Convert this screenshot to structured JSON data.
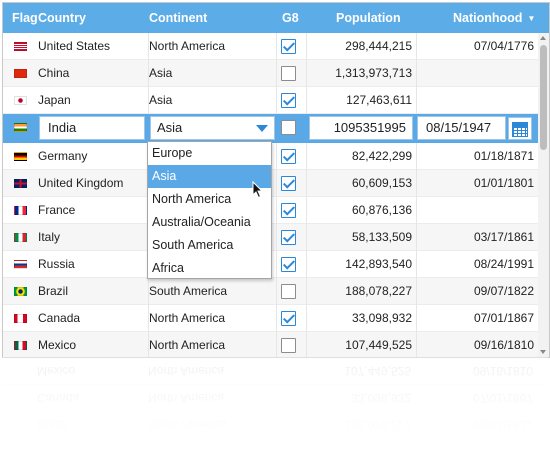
{
  "columns": {
    "flag": "Flag",
    "country": "Country",
    "continent": "Continent",
    "g8": "G8",
    "population": "Population",
    "nationhood": "Nationhood"
  },
  "rows": [
    {
      "flag": "us-flag",
      "country": "United States",
      "continent": "North America",
      "g8": true,
      "population": "298,444,215",
      "nationhood": "07/04/1776"
    },
    {
      "flag": "cn-flag",
      "country": "China",
      "continent": "Asia",
      "g8": false,
      "population": "1,313,973,713",
      "nationhood": ""
    },
    {
      "flag": "jp-flag",
      "country": "Japan",
      "continent": "Asia",
      "g8": true,
      "population": "127,463,611",
      "nationhood": ""
    },
    {
      "flag": "in-flag",
      "country": "India",
      "continent": "Asia",
      "g8": false,
      "population": "1095351995",
      "nationhood": "08/15/1947",
      "editing": true
    },
    {
      "flag": "de-flag",
      "country": "Germany",
      "continent": "",
      "g8": true,
      "population": "82,422,299",
      "nationhood": "01/18/1871"
    },
    {
      "flag": "gb-flag",
      "country": "United Kingdom",
      "continent": "",
      "g8": true,
      "population": "60,609,153",
      "nationhood": "01/01/1801"
    },
    {
      "flag": "fr-flag",
      "country": "France",
      "continent": "",
      "g8": true,
      "population": "60,876,136",
      "nationhood": ""
    },
    {
      "flag": "it-flag",
      "country": "Italy",
      "continent": "",
      "g8": true,
      "population": "58,133,509",
      "nationhood": "03/17/1861"
    },
    {
      "flag": "ru-flag",
      "country": "Russia",
      "continent": "",
      "g8": true,
      "population": "142,893,540",
      "nationhood": "08/24/1991"
    },
    {
      "flag": "br-flag",
      "country": "Brazil",
      "continent": "South America",
      "g8": false,
      "population": "188,078,227",
      "nationhood": "09/07/1822"
    },
    {
      "flag": "ca-flag",
      "country": "Canada",
      "continent": "North America",
      "g8": true,
      "population": "33,098,932",
      "nationhood": "07/01/1867"
    },
    {
      "flag": "mx-flag",
      "country": "Mexico",
      "continent": "North America",
      "g8": false,
      "population": "107,449,525",
      "nationhood": "09/16/1810"
    }
  ],
  "dropdown": {
    "options": [
      "Europe",
      "Asia",
      "North America",
      "Australia/Oceania",
      "South America",
      "Africa"
    ],
    "selected": "Asia"
  },
  "colors": {
    "header_bg": "#5cace8",
    "accent": "#2b88d9",
    "edit_row_bg": "#5aa9e6"
  },
  "icons": {
    "sort": "sort-descending-icon",
    "calendar": "calendar-icon",
    "dropdown": "chevron-down-icon"
  }
}
